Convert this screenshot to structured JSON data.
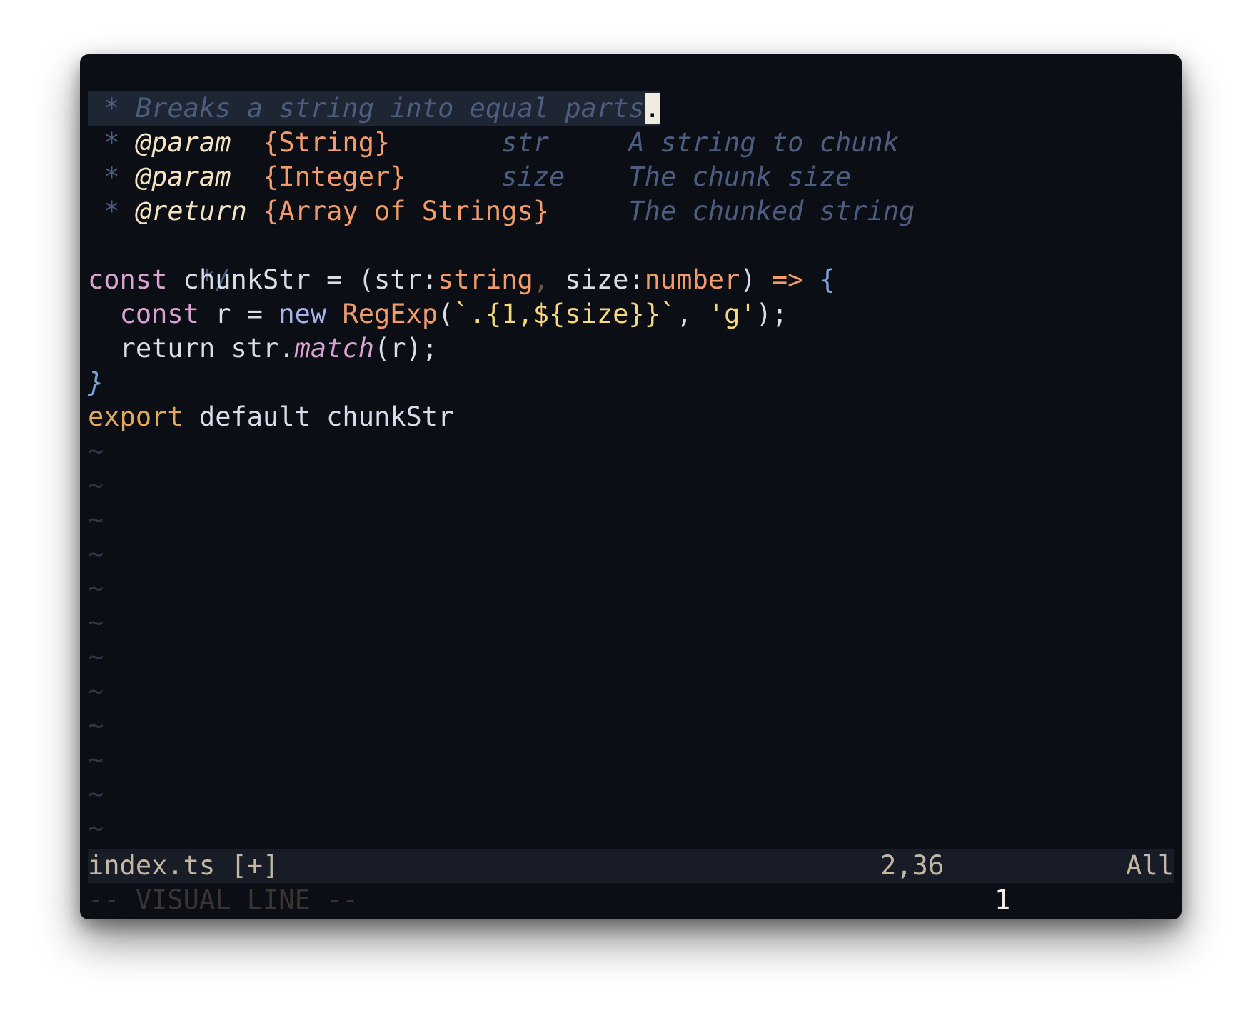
{
  "editor": {
    "lines": [
      {
        "type": "comment",
        "text": "/**"
      },
      {
        "type": "comment_selected",
        "text": " * Breaks a string into equal parts",
        "cursor_char": "."
      },
      {
        "type": "param",
        "star": " * ",
        "tag": "@param",
        "gap1": "  ",
        "ptype": "{String}",
        "gap2": "       ",
        "name": "str",
        "gap3": "     ",
        "desc": "A string to chunk"
      },
      {
        "type": "param",
        "star": " * ",
        "tag": "@param",
        "gap1": "  ",
        "ptype": "{Integer}",
        "gap2": "      ",
        "name": "size",
        "gap3": "    ",
        "desc": "The chunk size"
      },
      {
        "type": "param",
        "star": " * ",
        "tag": "@return",
        "gap1": " ",
        "ptype": "{Array of Strings}",
        "gap2": "     ",
        "name": "",
        "gap3": "",
        "desc": "The chunked string"
      },
      {
        "type": "comment",
        "text": " */"
      }
    ],
    "code": {
      "l1_const": "const",
      "l1_name": " chunkStr = (str:",
      "l1_type1": "string",
      "l1_comma": ",",
      "l1_mid": " size:",
      "l1_type2": "number",
      "l1_paren": ")",
      "l1_arrow": " =>",
      "l1_brace": " {",
      "l2_indent": "  ",
      "l2_const": "const",
      "l2_mid": " r = ",
      "l2_new": "new",
      "l2_space": " ",
      "l2_regexp": "RegExp",
      "l2_open": "(",
      "l2_template": "`.{1,${size}}`",
      "l2_comma": ", ",
      "l2_flag": "'g'",
      "l2_close": ");",
      "l3_indent": "  ",
      "l3_return": "return str.",
      "l3_match": "match",
      "l3_rest": "(r);",
      "l4_brace": "}",
      "l5_export": "export",
      "l5_rest": " default chunkStr"
    },
    "tilde": "~",
    "tilde_count": 12
  },
  "statusline": {
    "filename": "index.ts [+]",
    "position": "2,36",
    "percent": "All"
  },
  "cmdline": {
    "mode": "-- VISUAL LINE --",
    "showcmd": "1"
  },
  "colors": {
    "background": "#0b0e15",
    "comment": "#4c5d80",
    "doc_tag": "#f4e4c3",
    "type": "#f29b6b",
    "keyword": "#d9a3d1",
    "string": "#f5d97a",
    "brace": "#7ea3d8",
    "export": "#e2a85b"
  }
}
